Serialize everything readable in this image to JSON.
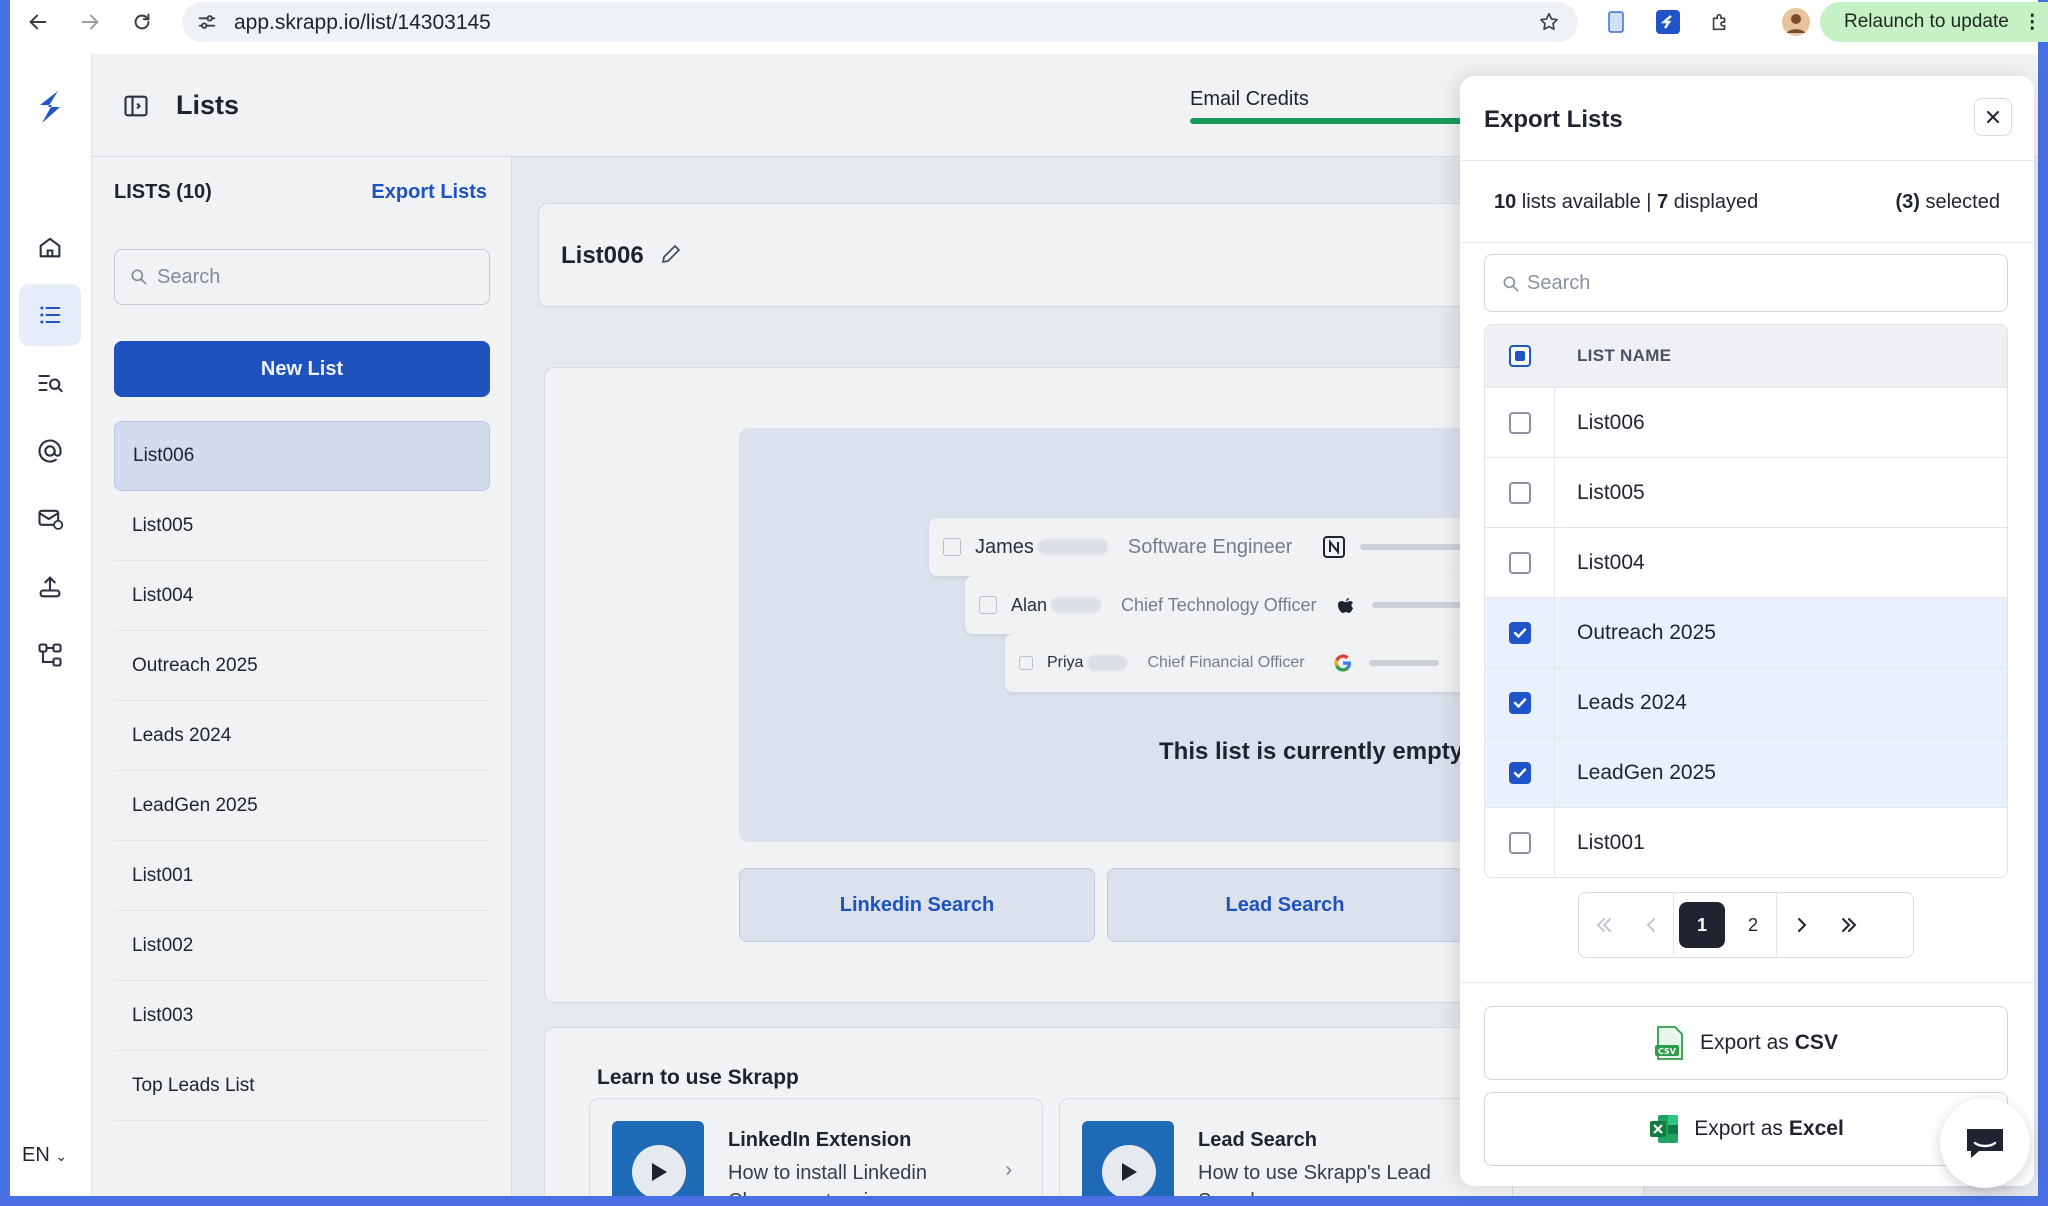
{
  "browser": {
    "url": "app.skrapp.io/list/14303145",
    "relaunch_label": "Relaunch to update"
  },
  "app": {
    "page_title": "Lists",
    "language": "EN",
    "email_credits_label": "Email Credits",
    "accent_color": "#1f55c8"
  },
  "lists_panel": {
    "heading": "LISTS (10)",
    "export_link": "Export Lists",
    "search_placeholder": "Search",
    "new_list_label": "New List",
    "items": [
      {
        "label": "List006",
        "active": true
      },
      {
        "label": "List005"
      },
      {
        "label": "List004"
      },
      {
        "label": "Outreach 2025"
      },
      {
        "label": "Leads 2024"
      },
      {
        "label": "LeadGen 2025"
      },
      {
        "label": "List001"
      },
      {
        "label": "List002"
      },
      {
        "label": "List003"
      },
      {
        "label": "Top Leads List"
      }
    ]
  },
  "main": {
    "list_title": "List006",
    "empty_message": "This list is currently empty.",
    "illustration_rows": [
      {
        "name": "James",
        "role": "Software Engineer",
        "logo": "notion-icon"
      },
      {
        "name": "Alan",
        "role": "Chief Technology Officer",
        "logo": "apple-icon"
      },
      {
        "name": "Priya",
        "role": "Chief Financial Officer",
        "logo": "google-icon"
      }
    ],
    "linkedin_search_label": "Linkedin Search",
    "lead_search_label": "Lead Search",
    "learn_title": "Learn to use Skrapp",
    "videos": [
      {
        "title": "LinkedIn Extension",
        "subtitle": "How to install Linkedin Chrome extension"
      },
      {
        "title": "Lead Search",
        "subtitle": "How to use Skrapp's Lead Search"
      }
    ]
  },
  "modal": {
    "title": "Export Lists",
    "available_count": "10",
    "available_text": " lists available | ",
    "displayed_count": "7",
    "displayed_text": " displayed",
    "selected_count": "(3)",
    "selected_text": " selected",
    "search_placeholder": "Search",
    "column_header": "LIST NAME",
    "rows": [
      {
        "name": "List006",
        "checked": false
      },
      {
        "name": "List005",
        "checked": false
      },
      {
        "name": "List004",
        "checked": false
      },
      {
        "name": "Outreach 2025",
        "checked": true
      },
      {
        "name": "Leads 2024",
        "checked": true
      },
      {
        "name": "LeadGen 2025",
        "checked": true
      },
      {
        "name": "List001",
        "checked": false
      }
    ],
    "pagination": {
      "current": "1",
      "next": "2"
    },
    "export_csv_prefix": "Export as",
    "export_csv_format": "CSV",
    "export_excel_prefix": "Export as",
    "export_excel_format": "Excel"
  }
}
